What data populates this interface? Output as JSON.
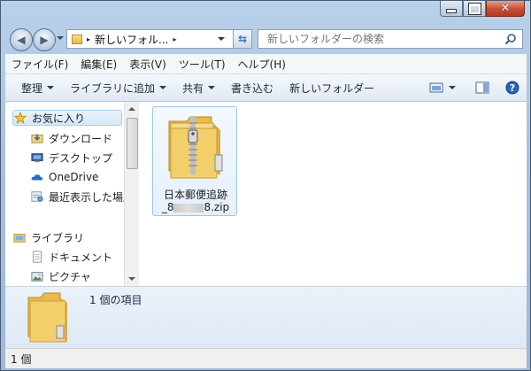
{
  "address": {
    "crumb": "新しいフォル...",
    "separator": "▸"
  },
  "search": {
    "placeholder": "新しいフォルダーの検索"
  },
  "menubar": {
    "items": [
      "ファイル(F)",
      "編集(E)",
      "表示(V)",
      "ツール(T)",
      "ヘルプ(H)"
    ]
  },
  "toolbar": {
    "items": [
      "整理",
      "ライブラリに追加",
      "共有",
      "書き込む",
      "新しいフォルダー"
    ]
  },
  "sidebar": {
    "favorites": "お気に入り",
    "favorite_items": [
      "ダウンロード",
      "デスクトップ",
      "OneDrive",
      "最近表示した場所"
    ],
    "libraries": "ライブラリ",
    "library_items": [
      "ドキュメント",
      "ピクチャ"
    ]
  },
  "file": {
    "name_line1": "日本郵便追跡",
    "name_line2_start": "_8",
    "name_line2_end": "8.zip"
  },
  "details": {
    "count": "1 個の項目"
  },
  "status": {
    "text": "1 個"
  },
  "colors": {
    "accent": "#3a78c4",
    "close": "#c74c34",
    "selection": "#d7e8fb"
  }
}
